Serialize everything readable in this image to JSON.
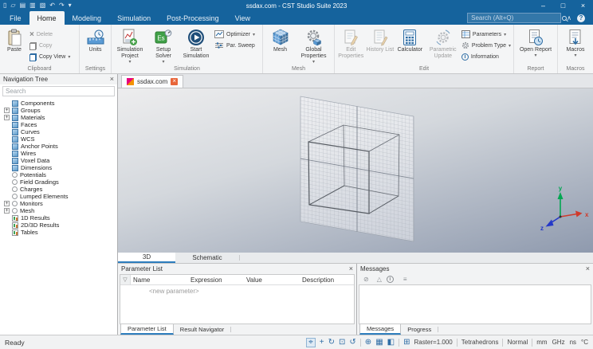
{
  "titlebar": {
    "title": "ssdax.com - CST Studio Suite 2023",
    "search_placeholder": "Search (Alt+Q)"
  },
  "tabs": {
    "file": "File",
    "home": "Home",
    "modeling": "Modeling",
    "simulation": "Simulation",
    "post_processing": "Post-Processing",
    "view": "View"
  },
  "ribbon": {
    "clipboard": {
      "group": "Clipboard",
      "paste": "Paste",
      "delete": "Delete",
      "copy": "Copy",
      "copy_view": "Copy View"
    },
    "settings": {
      "group": "Settings",
      "units": "Units"
    },
    "simulation": {
      "group": "Simulation",
      "simulation_project": "Simulation Project",
      "setup_solver": "Setup Solver",
      "start_simulation": "Start Simulation",
      "optimizer": "Optimizer",
      "par_sweep": "Par. Sweep"
    },
    "mesh": {
      "group": "Mesh",
      "mesh": "Mesh",
      "global_properties": "Global Properties"
    },
    "edit": {
      "group": "Edit",
      "edit_properties": "Edit Properties",
      "history_list": "History List",
      "calculator": "Calculator",
      "parametric_update": "Parametric Update",
      "parameters": "Parameters",
      "problem_type": "Problem Type",
      "information": "Information"
    },
    "report": {
      "group": "Report",
      "open_report": "Open Report"
    },
    "macros": {
      "group": "Macros",
      "macros": "Macros"
    }
  },
  "nav": {
    "title": "Navigation Tree",
    "search_placeholder": "Search",
    "items": [
      {
        "label": "Components"
      },
      {
        "label": "Groups"
      },
      {
        "label": "Materials"
      },
      {
        "label": "Faces"
      },
      {
        "label": "Curves"
      },
      {
        "label": "WCS"
      },
      {
        "label": "Anchor Points"
      },
      {
        "label": "Wires"
      },
      {
        "label": "Voxel Data"
      },
      {
        "label": "Dimensions"
      },
      {
        "label": "Potentials"
      },
      {
        "label": "Field Gradings"
      },
      {
        "label": "Charges"
      },
      {
        "label": "Lumped Elements"
      },
      {
        "label": "Monitors"
      },
      {
        "label": "Mesh"
      },
      {
        "label": "1D Results"
      },
      {
        "label": "2D/3D Results"
      },
      {
        "label": "Tables"
      }
    ]
  },
  "document_tab": {
    "label": "ssdax.com"
  },
  "viewport": {
    "axis_x": "x",
    "axis_y": "y",
    "axis_z": "z"
  },
  "view_tabs": {
    "three_d": "3D",
    "schematic": "Schematic"
  },
  "parameter_panel": {
    "title": "Parameter List",
    "columns": {
      "name": "Name",
      "expression": "Expression",
      "value": "Value",
      "description": "Description"
    },
    "new_parameter": "<new parameter>",
    "tab_parameter_list": "Parameter List",
    "tab_result_navigator": "Result Navigator"
  },
  "messages_panel": {
    "title": "Messages",
    "tab_messages": "Messages",
    "tab_progress": "Progress"
  },
  "statusbar": {
    "ready": "Ready",
    "raster": "Raster=1.000",
    "mesh_type": "Tetrahedrons",
    "mode": "Normal",
    "units": {
      "length": "mm",
      "frequency": "GHz",
      "time": "ns",
      "temperature": "°C"
    }
  },
  "icons": {
    "chevron_down": "▾",
    "close": "×",
    "minimize": "–",
    "maximize": "□",
    "caret_up": "∧",
    "help": "?",
    "plus": "+",
    "filter": "▽",
    "error": "⊘",
    "warning": "△",
    "info_letter": "i",
    "list": "≡",
    "delete_x": "×",
    "solver_badge": "Es",
    "qat_new": "▯",
    "qat_open": "▱",
    "qat_save": "▤",
    "qat_save_all": "▥",
    "qat_export": "▧",
    "qat_undo": "↶",
    "qat_redo": "↷",
    "st_fit": "⌖",
    "st_pan": "+",
    "st_rotate": "↻",
    "st_zoom_window": "⊡",
    "st_spin": "↺",
    "st_zoom": "⊕",
    "st_windows": "▦",
    "st_cube": "◧",
    "st_external": "⊞"
  }
}
